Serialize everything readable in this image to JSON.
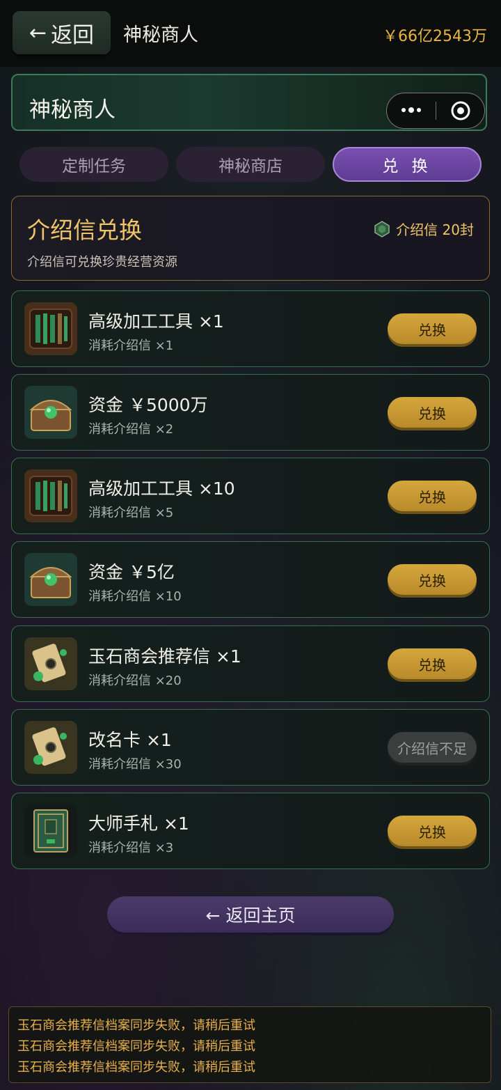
{
  "topbar": {
    "back_label": "返回",
    "title": "神秘商人",
    "money": "￥66亿2543万"
  },
  "header": {
    "title": "神秘商人"
  },
  "tabs": [
    {
      "label": "定制任务",
      "active": false
    },
    {
      "label": "神秘商店",
      "active": false
    },
    {
      "label": "兑 换",
      "active": true
    }
  ],
  "exchange": {
    "title": "介绍信兑换",
    "subtitle": "介绍信可兑换珍贵经营资源",
    "letter_count": "介绍信 20封"
  },
  "items": [
    {
      "name": "高级加工工具 ×1",
      "cost": "消耗介绍信 ×1",
      "button": "兑换",
      "icon": "tools-icon",
      "enabled": true
    },
    {
      "name": "资金 ￥5000万",
      "cost": "消耗介绍信 ×2",
      "button": "兑换",
      "icon": "treasure-chest-icon",
      "enabled": true
    },
    {
      "name": "高级加工工具 ×10",
      "cost": "消耗介绍信 ×5",
      "button": "兑换",
      "icon": "tools-icon",
      "enabled": true
    },
    {
      "name": "资金 ￥5亿",
      "cost": "消耗介绍信 ×10",
      "button": "兑换",
      "icon": "treasure-chest-icon",
      "enabled": true
    },
    {
      "name": "玉石商会推荐信 ×1",
      "cost": "消耗介绍信 ×20",
      "button": "兑换",
      "icon": "scroll-jade-icon",
      "enabled": true
    },
    {
      "name": "改名卡 ×1",
      "cost": "消耗介绍信 ×30",
      "button": "介绍信不足",
      "icon": "scroll-jade-icon",
      "enabled": false
    },
    {
      "name": "大师手札 ×1",
      "cost": "消耗介绍信 ×3",
      "button": "兑换",
      "icon": "book-icon",
      "enabled": true
    }
  ],
  "home_button": "← 返回主页",
  "toasts": [
    "玉石商会推荐信档案同步失败，请稍后重试",
    "玉石商会推荐信档案同步失败，请稍后重试",
    "玉石商会推荐信档案同步失败，请稍后重试"
  ],
  "colors": {
    "gold": "#f0c469",
    "active_tab": "#6a44a0",
    "button_gold": "#c8982f",
    "item_border": "#3a6e52"
  }
}
